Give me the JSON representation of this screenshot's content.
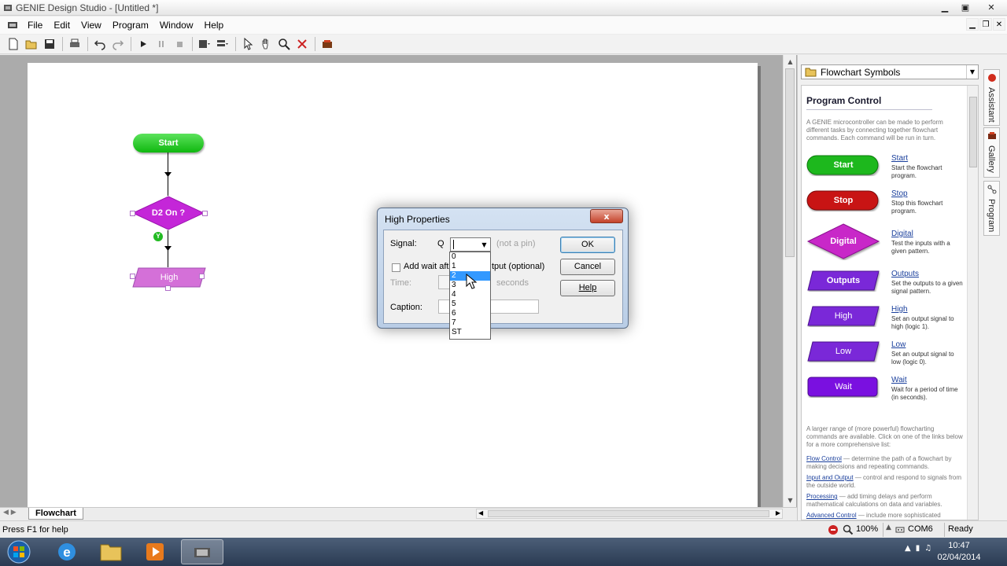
{
  "window": {
    "title": "GENIE Design Studio - [Untitled *]"
  },
  "menu": [
    "File",
    "Edit",
    "View",
    "Program",
    "Window",
    "Help"
  ],
  "toolbar": {
    "icons": [
      "new-icon",
      "open-icon",
      "save-icon",
      "print-icon",
      "undo-icon",
      "redo-icon",
      "run-icon",
      "pause-icon",
      "stop-icon",
      "layout-icon",
      "align-icon",
      "pointer-icon",
      "hand-icon",
      "zoom-icon",
      "delete-icon",
      "chip-icon"
    ]
  },
  "flowchart": {
    "start_label": "Start",
    "decision_label": "D2 On ?",
    "yes_marker": "Y",
    "high_label": "High",
    "tab_label": "Flowchart"
  },
  "panel": {
    "combo_label": "Flowchart Symbols",
    "title": "Program Control",
    "intro": "A GENIE microcontroller can be made to perform different tasks by connecting together flowchart commands. Each command will be run in turn.",
    "symbols": [
      {
        "label": "Start",
        "link": "Start",
        "desc": "Start the flowchart program.",
        "color": "#1db81d"
      },
      {
        "label": "Stop",
        "link": "Stop",
        "desc": "Stop this flowchart program.",
        "color": "#c81414"
      },
      {
        "label": "Digital",
        "link": "Digital",
        "desc": "Test the inputs with a given pattern.",
        "color": "#c828c8"
      },
      {
        "label": "Outputs",
        "link": "Outputs",
        "desc": "Set the outputs to a given signal pattern.",
        "color": "#7a28d8"
      },
      {
        "label": "High",
        "link": "High",
        "desc": "Set an output signal to high (logic 1).",
        "color": "#7a28d8"
      },
      {
        "label": "Low",
        "link": "Low",
        "desc": "Set an output signal to low (logic 0).",
        "color": "#7a28d8"
      },
      {
        "label": "Wait",
        "link": "Wait",
        "desc": "Wait for a period of time (in seconds).",
        "color": "#7a10e0"
      }
    ],
    "more_intro": "A larger range of (more powerful) flowcharting commands are available. Click on one of the links below for a more comprehensive list:",
    "more": [
      {
        "link": "Flow Control",
        "text": " — determine the path of a flowchart by making decisions and repeating commands."
      },
      {
        "link": "Input and Output",
        "text": " — control and respond to signals from the outside world."
      },
      {
        "link": "Processing",
        "text": " — add timing delays and perform mathematical calculations on data and variables."
      },
      {
        "link": "Advanced Control",
        "text": " — include more sophisticated"
      }
    ]
  },
  "sidetabs": [
    "Assistant",
    "Gallery",
    "Program"
  ],
  "dialog": {
    "title": "High Properties",
    "close_label": "x",
    "signal_label": "Signal:",
    "signal_prefix": "Q",
    "not_a_pin": "(not a pin)",
    "add_wait_label": "Add wait afte",
    "add_wait_rest": "tput (optional)",
    "time_label": "Time:",
    "seconds_label": "seconds",
    "caption_label": "Caption:",
    "ok": "OK",
    "cancel": "Cancel",
    "help": "Help",
    "options": [
      "0",
      "1",
      "2",
      "3",
      "4",
      "5",
      "6",
      "7",
      "ST"
    ],
    "selected_option": "2"
  },
  "status": {
    "help_text": "Press F1 for help",
    "zoom": "100%",
    "port": "COM6",
    "ready": "Ready"
  },
  "taskbar": {
    "time": "10:47",
    "date": "02/04/2014"
  }
}
